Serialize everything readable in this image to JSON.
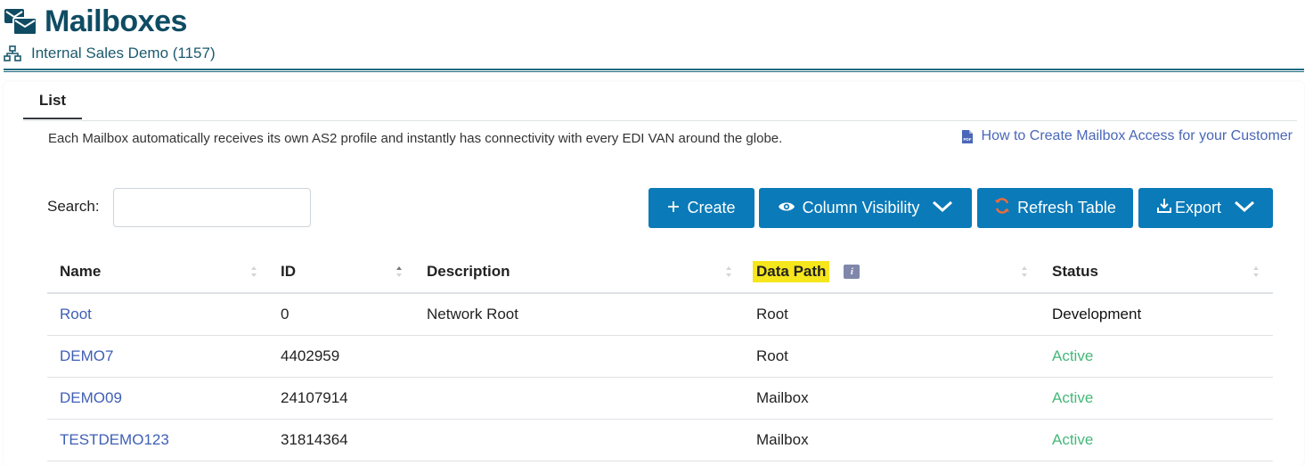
{
  "header": {
    "title": "Mailboxes",
    "title_icon": "mailboxes-icon",
    "subtitle": "Internal Sales Demo (1157)",
    "subtitle_icon": "network-icon"
  },
  "tabs": [
    {
      "label": "List"
    }
  ],
  "description": "Each Mailbox automatically receives its own AS2 profile and instantly has connectivity with every EDI VAN around the globe.",
  "help_link": {
    "label": "How to Create Mailbox Access for your Customer",
    "icon": "pdf-icon"
  },
  "search": {
    "label": "Search:",
    "value": "",
    "placeholder": ""
  },
  "buttons": {
    "create": "Create",
    "column_visibility": "Column Visibility",
    "refresh": "Refresh Table",
    "export": "Export"
  },
  "table": {
    "columns": [
      "Name",
      "ID",
      "Description",
      "Data Path",
      "Status"
    ],
    "rows": [
      {
        "name": "Root",
        "id": "0",
        "description": "Network Root",
        "data_path": "Root",
        "status": "Development"
      },
      {
        "name": "DEMO7",
        "id": "4402959",
        "description": "",
        "data_path": "Root",
        "status": "Active"
      },
      {
        "name": "DEMO09",
        "id": "24107914",
        "description": "",
        "data_path": "Mailbox",
        "status": "Active"
      },
      {
        "name": "TESTDEMO123",
        "id": "31814364",
        "description": "",
        "data_path": "Mailbox",
        "status": "Active"
      }
    ]
  },
  "colors": {
    "primary_button": "#0a7ab8",
    "title": "#0f4c63",
    "link": "#3f5fb6",
    "active_status": "#45b87a",
    "highlight": "#f6e61c"
  }
}
